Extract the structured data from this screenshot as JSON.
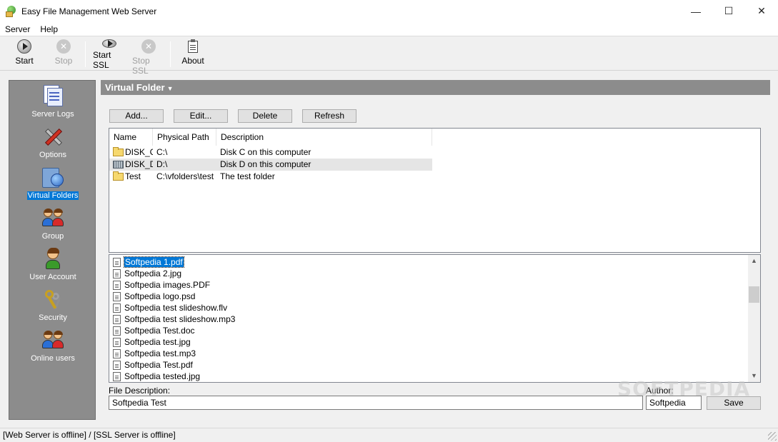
{
  "window": {
    "title": "Easy File Management Web Server",
    "controls": {
      "minimize": "—",
      "maximize": "☐",
      "close": "✕"
    }
  },
  "menu": [
    "Server",
    "Help"
  ],
  "toolbar": {
    "start": "Start",
    "stop": "Stop",
    "start_ssl": "Start SSL",
    "stop_ssl": "Stop SSL",
    "about": "About"
  },
  "sidebar": {
    "items": [
      {
        "label": "Server Logs",
        "icon": "server-logs-icon"
      },
      {
        "label": "Options",
        "icon": "options-icon"
      },
      {
        "label": "Virtual Folders",
        "icon": "virtual-folders-icon",
        "selected": true
      },
      {
        "label": "Group",
        "icon": "group-icon"
      },
      {
        "label": "User Account",
        "icon": "user-account-icon"
      },
      {
        "label": "Security",
        "icon": "security-icon"
      },
      {
        "label": "Online users",
        "icon": "online-users-icon"
      }
    ]
  },
  "panel": {
    "title": "Virtual Folder",
    "caret": "▼",
    "buttons": {
      "add": "Add...",
      "edit": "Edit...",
      "delete": "Delete",
      "refresh": "Refresh"
    }
  },
  "virtual_folders": {
    "columns": [
      "Name",
      "Physical Path",
      "Description"
    ],
    "rows": [
      {
        "name": "DISK_C",
        "path": "C:\\",
        "description": "Disk C on this computer",
        "icon": "folder"
      },
      {
        "name": "DISK_D",
        "path": "D:\\",
        "description": "Disk D on this computer",
        "icon": "drive",
        "highlighted": true
      },
      {
        "name": "Test",
        "path": "C:\\vfolders\\test",
        "description": "The test folder",
        "icon": "folder"
      }
    ]
  },
  "files": [
    "Softpedia 1.pdf",
    "Softpedia 2.jpg",
    "Softpedia images.PDF",
    "Softpedia logo.psd",
    "Softpedia test slideshow.flv",
    "Softpedia test slideshow.mp3",
    "Softpedia Test.doc",
    "Softpedia test.jpg",
    "Softpedia test.mp3",
    "Softpedia Test.pdf",
    "Softpedia tested.jpg"
  ],
  "selected_file": "Softpedia 1.pdf",
  "file_description": {
    "label": "File Description:",
    "value": "Softpedia Test"
  },
  "author": {
    "label": "Author:",
    "value": "Softpedia"
  },
  "save_label": "Save",
  "watermark": "SOFTPEDIA",
  "status": "[Web Server is offline] / [SSL Server is offline]",
  "colors": {
    "sidebar": "#8c8c8c",
    "selection": "#0078d7",
    "panel_header": "#8c8c8c"
  }
}
